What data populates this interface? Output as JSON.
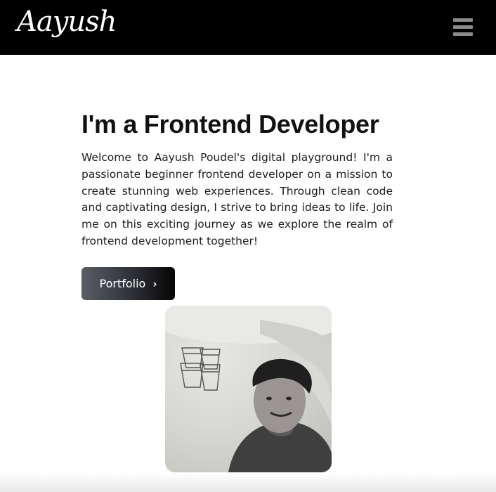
{
  "navbar": {
    "logo_text": "Aayush",
    "menu_icon": "hamburger-menu-icon"
  },
  "hero": {
    "title": "I'm a Frontend Developer",
    "description": "Welcome to Aayush Poudel's digital playground! I'm a passionate beginner frontend developer on a mission to create stunning web experiences. Through clean code and captivating design, I strive to bring ideas to life. Join me on this exciting journey as we explore the realm of frontend development together!",
    "button_label": "Portfolio",
    "button_icon": "chevron-right-icon",
    "button_chevron": "›"
  },
  "profile_photo": {
    "icon": "profile-photo",
    "description_alt": "Aayush Poudel"
  },
  "colors": {
    "navbar_bg": "#000000",
    "logo": "#ffffff",
    "menu_icon": "#8b8b8b",
    "button_gradient_start": "#5a5d66",
    "button_gradient_end": "#050506"
  }
}
